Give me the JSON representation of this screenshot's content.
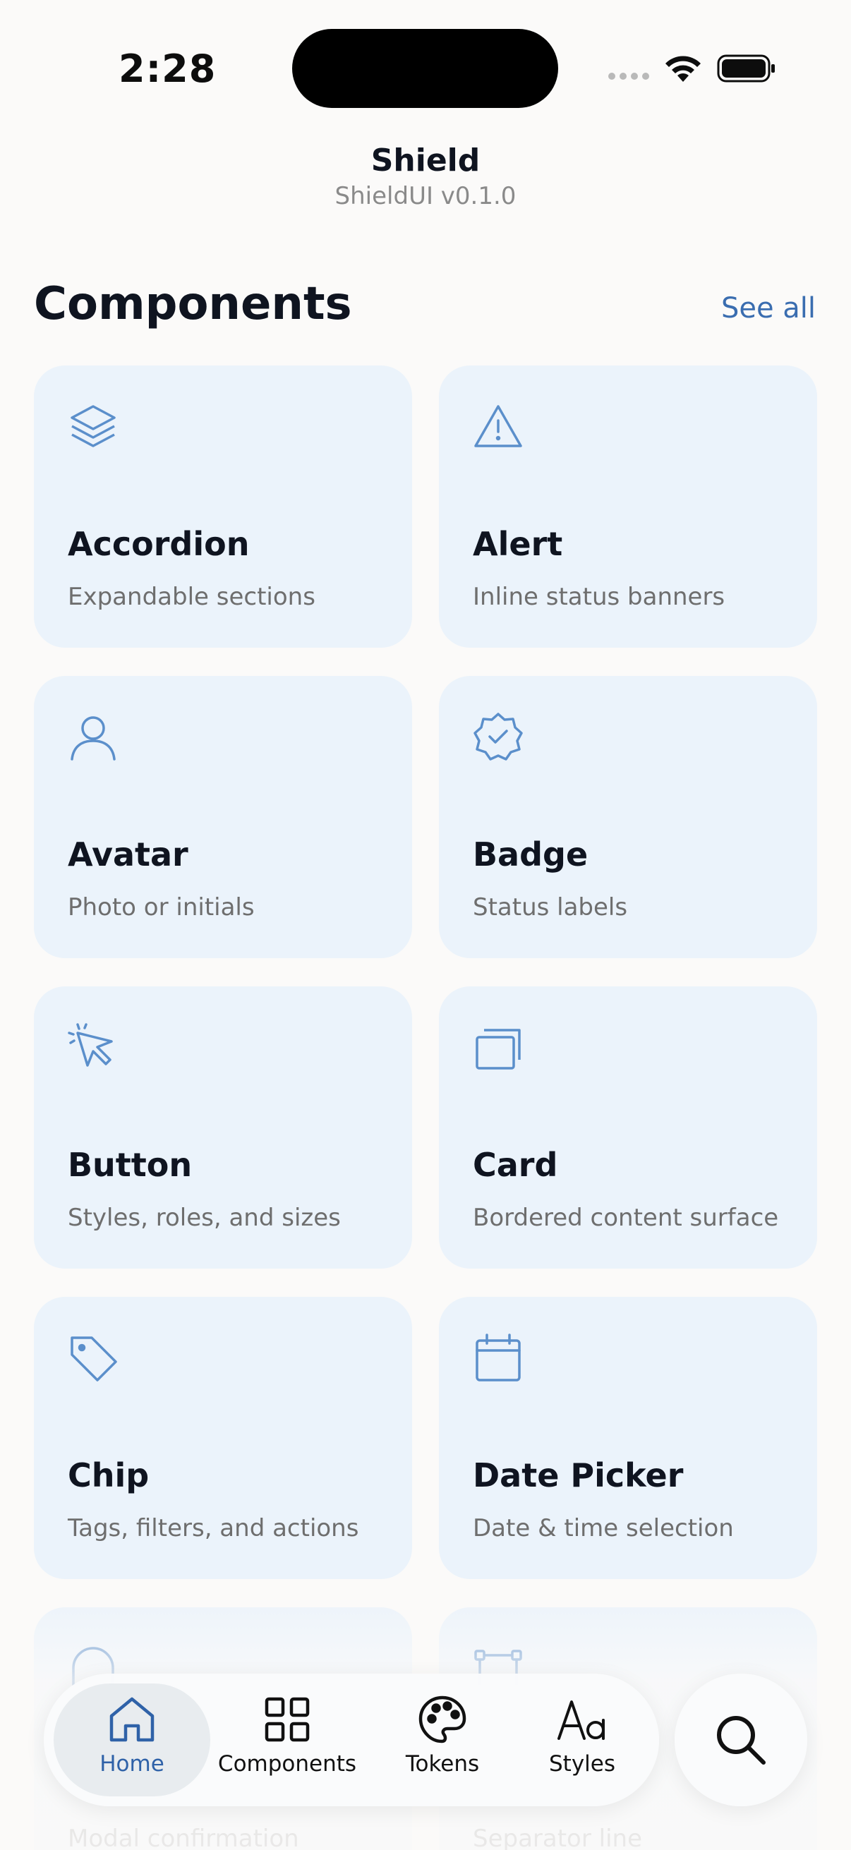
{
  "status_bar": {
    "time": "2:28"
  },
  "nav": {
    "title": "Shield",
    "subtitle": "ShieldUI v0.1.0"
  },
  "section": {
    "title": "Components",
    "see_all": "See all"
  },
  "colors": {
    "accent": "#3A6DB0",
    "icon": "#5B8FCB",
    "card_bg": "#EBF3FB",
    "background": "#FBFAF9"
  },
  "cards": [
    {
      "icon": "layers-icon",
      "title": "Accordion",
      "subtitle": "Expandable sections"
    },
    {
      "icon": "warning-triangle-icon",
      "title": "Alert",
      "subtitle": "Inline status banners"
    },
    {
      "icon": "user-icon",
      "title": "Avatar",
      "subtitle": "Photo or initials"
    },
    {
      "icon": "verified-badge-icon",
      "title": "Badge",
      "subtitle": "Status labels"
    },
    {
      "icon": "cursor-click-icon",
      "title": "Button",
      "subtitle": "Styles, roles, and sizes"
    },
    {
      "icon": "stacked-cards-icon",
      "title": "Card",
      "subtitle": "Bordered content surface"
    },
    {
      "icon": "tag-icon",
      "title": "Chip",
      "subtitle": "Tags, filters, and actions"
    },
    {
      "icon": "calendar-icon",
      "title": "Date Picker",
      "subtitle": "Date & time selection"
    },
    {
      "icon": "dialog-icon",
      "title": "",
      "subtitle": "Modal confirmation"
    },
    {
      "icon": "divider-icon",
      "title": "",
      "subtitle": "Separator line"
    }
  ],
  "tabs": [
    {
      "icon": "home-icon",
      "label": "Home",
      "active": true
    },
    {
      "icon": "grid-icon",
      "label": "Components",
      "active": false
    },
    {
      "icon": "palette-icon",
      "label": "Tokens",
      "active": false
    },
    {
      "icon": "typography-icon",
      "label": "Styles",
      "active": false
    }
  ],
  "search_fab": {
    "icon": "search-icon"
  }
}
